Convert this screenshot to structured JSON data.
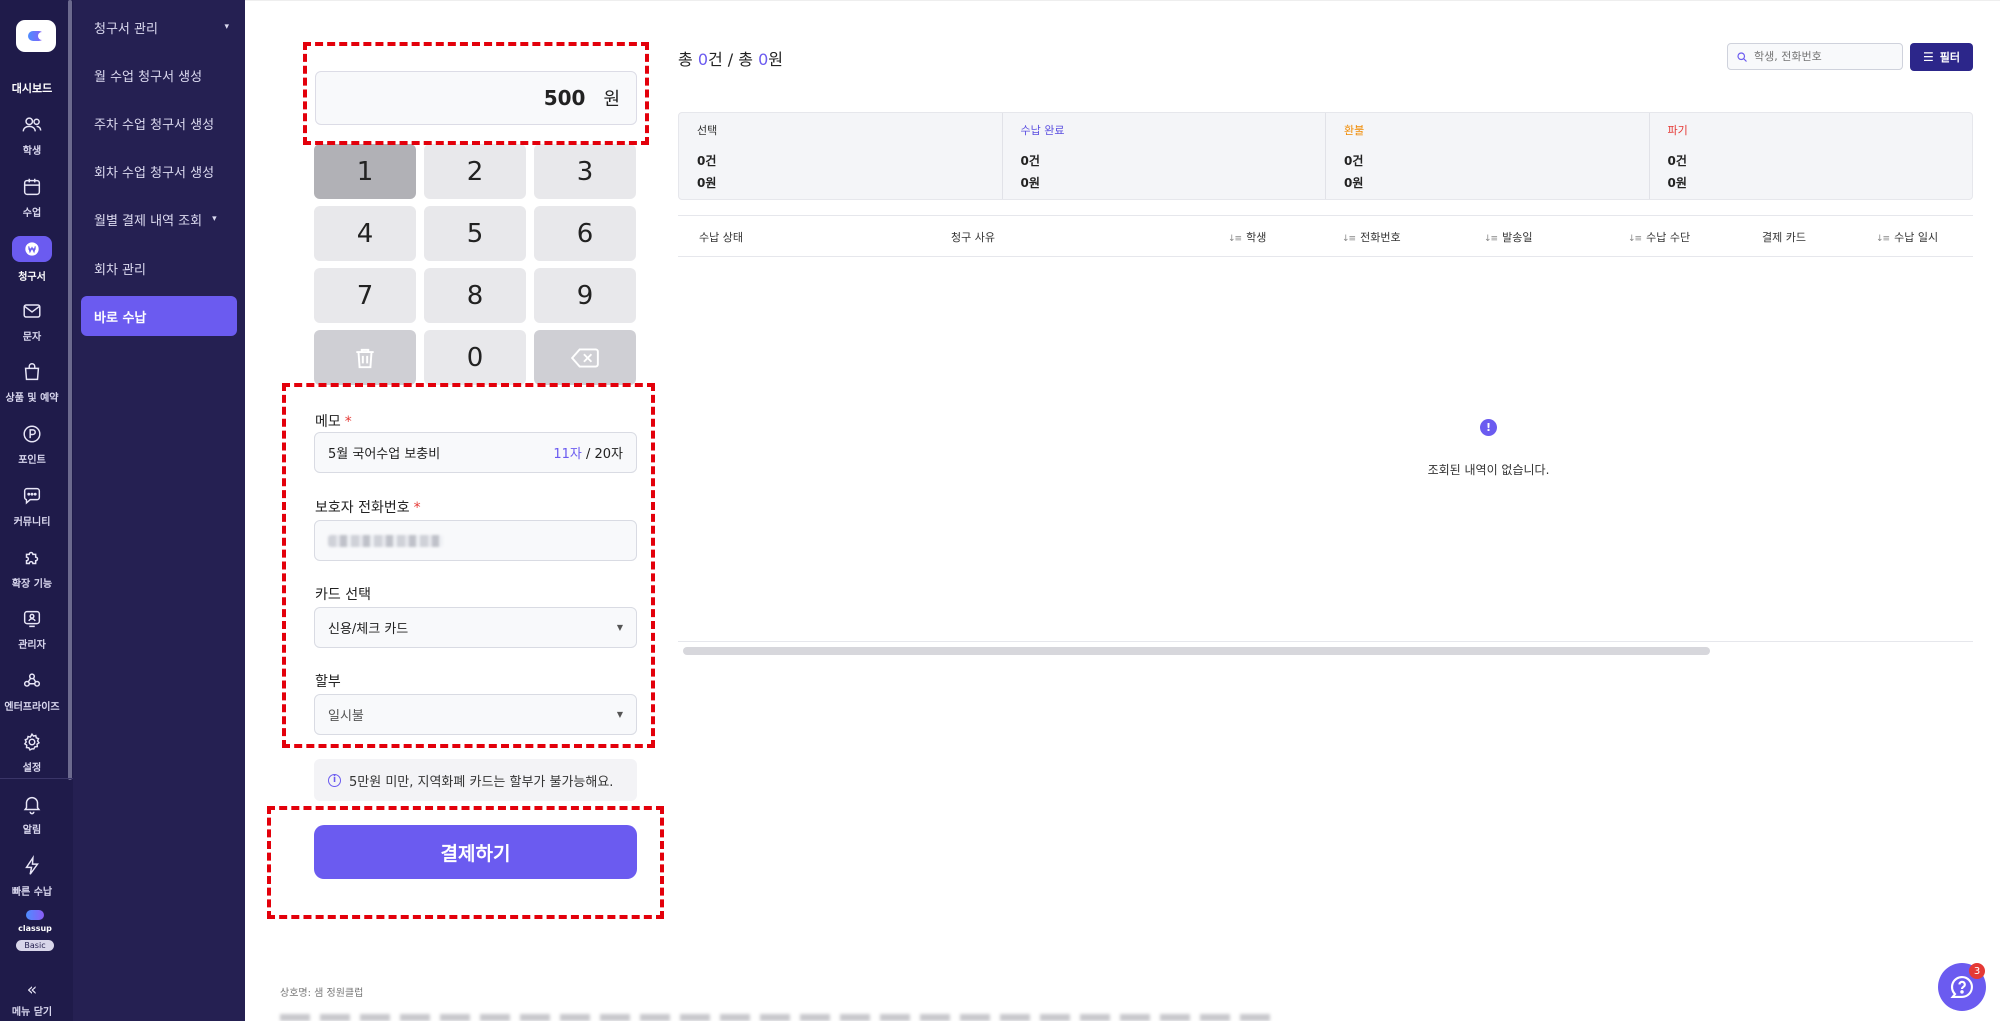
{
  "rail": {
    "dashboard_label": "대시보드",
    "items": [
      {
        "label": "학생",
        "icon": "users-icon"
      },
      {
        "label": "수업",
        "icon": "calendar-icon"
      },
      {
        "label": "청구서",
        "icon": "won-icon"
      },
      {
        "label": "문자",
        "icon": "mail-icon"
      },
      {
        "label": "상품 및 예약",
        "icon": "shopping-bag-icon"
      },
      {
        "label": "포인트",
        "icon": "point-icon"
      },
      {
        "label": "커뮤니티",
        "icon": "chat-icon"
      },
      {
        "label": "확장 기능",
        "icon": "puzzle-icon"
      },
      {
        "label": "관리자",
        "icon": "admin-icon"
      },
      {
        "label": "엔터프라이즈",
        "icon": "enterprise-icon"
      },
      {
        "label": "설정",
        "icon": "gear-icon"
      }
    ],
    "bottom": [
      {
        "label": "알림",
        "icon": "bell-icon"
      },
      {
        "label": "빠른 수납",
        "icon": "lightning-icon"
      }
    ],
    "brand_name": "classup",
    "plan_badge": "Basic",
    "collapse_label": "메뉴 닫기"
  },
  "submenu": {
    "items": [
      {
        "label": "청구서 관리",
        "caret": "▾"
      },
      {
        "label": "월 수업 청구서 생성",
        "caret": ""
      },
      {
        "label": "주차 수업 청구서 생성",
        "caret": ""
      },
      {
        "label": "회차 수업 청구서 생성",
        "caret": ""
      },
      {
        "label": "월별 결제 내역 조회",
        "caret": "▾"
      },
      {
        "label": "회차 관리",
        "caret": ""
      },
      {
        "label": "바로 수납",
        "caret": ""
      }
    ]
  },
  "pos": {
    "amount": "500",
    "unit": "원",
    "keys": [
      "1",
      "2",
      "3",
      "4",
      "5",
      "6",
      "7",
      "8",
      "9",
      "",
      "0",
      ""
    ],
    "memo": {
      "label": "메모",
      "required": "*",
      "value": "5월 국어수업 보충비",
      "count_current": "11자",
      "count_max": " / 20자"
    },
    "phone": {
      "label": "보호자 전화번호",
      "required": "*"
    },
    "card": {
      "label": "카드 선택",
      "value": "신용/체크 카드"
    },
    "installment": {
      "label": "할부",
      "value": "일시불"
    },
    "notice": "5만원 미만, 지역화폐 카드는 할부가 불가능해요.",
    "pay_button": "결제하기"
  },
  "list": {
    "total_prefix": "총 ",
    "total_count": "0",
    "total_mid": "건 / 총 ",
    "total_amount": "0",
    "total_suffix": "원",
    "search_placeholder": "학생, 전화번호",
    "filter_label": "필터",
    "summary": [
      {
        "title": "선택",
        "count": "0건",
        "amount": "0원"
      },
      {
        "title": "수납 완료",
        "count": "0건",
        "amount": "0원"
      },
      {
        "title": "환불",
        "count": "0건",
        "amount": "0원"
      },
      {
        "title": "파기",
        "count": "0건",
        "amount": "0원"
      }
    ],
    "columns": [
      "수납 상태",
      "청구 사유",
      "학생",
      "전화번호",
      "발송일",
      "수납 수단",
      "결제 카드",
      "수납 일시"
    ],
    "empty_message": "조회된 내역이 없습니다."
  },
  "footer": {
    "company": "상호명: 샘 정원클럽"
  },
  "help": {
    "badge": "3"
  },
  "colors": {
    "accent": "#6b5bf0",
    "rail_bg": "#1f1b4a",
    "submenu_bg": "#252052",
    "highlight_dash": "#e3000b",
    "refund": "#f08a00",
    "cancel": "#e53935"
  }
}
